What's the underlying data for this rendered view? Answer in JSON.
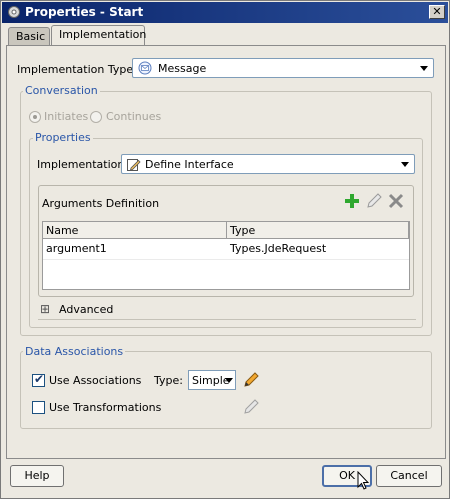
{
  "window": {
    "title": "Properties - Start",
    "close_label": "✕"
  },
  "tabs": [
    {
      "label": "Basic",
      "active": false
    },
    {
      "label": "Implementation",
      "active": true
    }
  ],
  "implementation_type": {
    "label": "Implementation Type:",
    "value": "Message",
    "icon": "message-icon"
  },
  "conversation": {
    "title": "Conversation",
    "options": [
      {
        "label": "Initiates",
        "checked": true,
        "enabled": false
      },
      {
        "label": "Continues",
        "checked": false,
        "enabled": false
      }
    ]
  },
  "properties": {
    "title": "Properties",
    "implementation_label": "Implementation:",
    "implementation_value": "Define Interface",
    "arguments": {
      "title": "Arguments Definition",
      "columns": [
        "Name",
        "Type"
      ],
      "rows": [
        {
          "name": "argument1",
          "type": "Types.JdeRequest"
        }
      ]
    },
    "advanced_label": "Advanced",
    "expand_symbol": "⊞"
  },
  "data_associations": {
    "title": "Data Associations",
    "use_associations_label": "Use Associations",
    "use_associations_checked": true,
    "type_label": "Type:",
    "type_value": "Simple",
    "use_transformations_label": "Use Transformations",
    "use_transformations_checked": false
  },
  "buttons": {
    "help": "Help",
    "ok": "OK",
    "cancel": "Cancel"
  },
  "colors": {
    "titlebar": "#0a246a",
    "group_title": "#2a56a8",
    "add_icon": "#2fa82f"
  }
}
